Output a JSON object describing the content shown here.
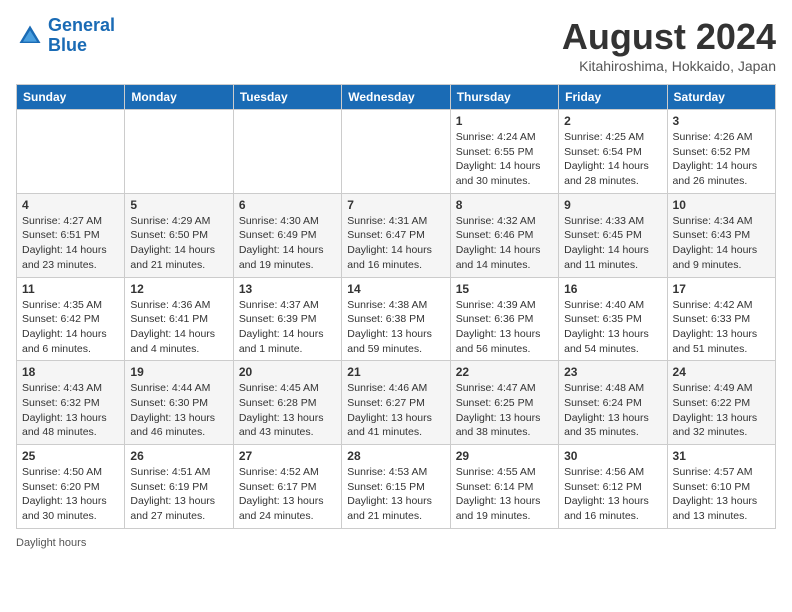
{
  "header": {
    "logo_line1": "General",
    "logo_line2": "Blue",
    "month_title": "August 2024",
    "subtitle": "Kitahiroshima, Hokkaido, Japan"
  },
  "days_of_week": [
    "Sunday",
    "Monday",
    "Tuesday",
    "Wednesday",
    "Thursday",
    "Friday",
    "Saturday"
  ],
  "weeks": [
    [
      {
        "day": "",
        "info": ""
      },
      {
        "day": "",
        "info": ""
      },
      {
        "day": "",
        "info": ""
      },
      {
        "day": "",
        "info": ""
      },
      {
        "day": "1",
        "info": "Sunrise: 4:24 AM\nSunset: 6:55 PM\nDaylight: 14 hours and 30 minutes."
      },
      {
        "day": "2",
        "info": "Sunrise: 4:25 AM\nSunset: 6:54 PM\nDaylight: 14 hours and 28 minutes."
      },
      {
        "day": "3",
        "info": "Sunrise: 4:26 AM\nSunset: 6:52 PM\nDaylight: 14 hours and 26 minutes."
      }
    ],
    [
      {
        "day": "4",
        "info": "Sunrise: 4:27 AM\nSunset: 6:51 PM\nDaylight: 14 hours and 23 minutes."
      },
      {
        "day": "5",
        "info": "Sunrise: 4:29 AM\nSunset: 6:50 PM\nDaylight: 14 hours and 21 minutes."
      },
      {
        "day": "6",
        "info": "Sunrise: 4:30 AM\nSunset: 6:49 PM\nDaylight: 14 hours and 19 minutes."
      },
      {
        "day": "7",
        "info": "Sunrise: 4:31 AM\nSunset: 6:47 PM\nDaylight: 14 hours and 16 minutes."
      },
      {
        "day": "8",
        "info": "Sunrise: 4:32 AM\nSunset: 6:46 PM\nDaylight: 14 hours and 14 minutes."
      },
      {
        "day": "9",
        "info": "Sunrise: 4:33 AM\nSunset: 6:45 PM\nDaylight: 14 hours and 11 minutes."
      },
      {
        "day": "10",
        "info": "Sunrise: 4:34 AM\nSunset: 6:43 PM\nDaylight: 14 hours and 9 minutes."
      }
    ],
    [
      {
        "day": "11",
        "info": "Sunrise: 4:35 AM\nSunset: 6:42 PM\nDaylight: 14 hours and 6 minutes."
      },
      {
        "day": "12",
        "info": "Sunrise: 4:36 AM\nSunset: 6:41 PM\nDaylight: 14 hours and 4 minutes."
      },
      {
        "day": "13",
        "info": "Sunrise: 4:37 AM\nSunset: 6:39 PM\nDaylight: 14 hours and 1 minute."
      },
      {
        "day": "14",
        "info": "Sunrise: 4:38 AM\nSunset: 6:38 PM\nDaylight: 13 hours and 59 minutes."
      },
      {
        "day": "15",
        "info": "Sunrise: 4:39 AM\nSunset: 6:36 PM\nDaylight: 13 hours and 56 minutes."
      },
      {
        "day": "16",
        "info": "Sunrise: 4:40 AM\nSunset: 6:35 PM\nDaylight: 13 hours and 54 minutes."
      },
      {
        "day": "17",
        "info": "Sunrise: 4:42 AM\nSunset: 6:33 PM\nDaylight: 13 hours and 51 minutes."
      }
    ],
    [
      {
        "day": "18",
        "info": "Sunrise: 4:43 AM\nSunset: 6:32 PM\nDaylight: 13 hours and 48 minutes."
      },
      {
        "day": "19",
        "info": "Sunrise: 4:44 AM\nSunset: 6:30 PM\nDaylight: 13 hours and 46 minutes."
      },
      {
        "day": "20",
        "info": "Sunrise: 4:45 AM\nSunset: 6:28 PM\nDaylight: 13 hours and 43 minutes."
      },
      {
        "day": "21",
        "info": "Sunrise: 4:46 AM\nSunset: 6:27 PM\nDaylight: 13 hours and 41 minutes."
      },
      {
        "day": "22",
        "info": "Sunrise: 4:47 AM\nSunset: 6:25 PM\nDaylight: 13 hours and 38 minutes."
      },
      {
        "day": "23",
        "info": "Sunrise: 4:48 AM\nSunset: 6:24 PM\nDaylight: 13 hours and 35 minutes."
      },
      {
        "day": "24",
        "info": "Sunrise: 4:49 AM\nSunset: 6:22 PM\nDaylight: 13 hours and 32 minutes."
      }
    ],
    [
      {
        "day": "25",
        "info": "Sunrise: 4:50 AM\nSunset: 6:20 PM\nDaylight: 13 hours and 30 minutes."
      },
      {
        "day": "26",
        "info": "Sunrise: 4:51 AM\nSunset: 6:19 PM\nDaylight: 13 hours and 27 minutes."
      },
      {
        "day": "27",
        "info": "Sunrise: 4:52 AM\nSunset: 6:17 PM\nDaylight: 13 hours and 24 minutes."
      },
      {
        "day": "28",
        "info": "Sunrise: 4:53 AM\nSunset: 6:15 PM\nDaylight: 13 hours and 21 minutes."
      },
      {
        "day": "29",
        "info": "Sunrise: 4:55 AM\nSunset: 6:14 PM\nDaylight: 13 hours and 19 minutes."
      },
      {
        "day": "30",
        "info": "Sunrise: 4:56 AM\nSunset: 6:12 PM\nDaylight: 13 hours and 16 minutes."
      },
      {
        "day": "31",
        "info": "Sunrise: 4:57 AM\nSunset: 6:10 PM\nDaylight: 13 hours and 13 minutes."
      }
    ]
  ],
  "footer_text": "Daylight hours"
}
